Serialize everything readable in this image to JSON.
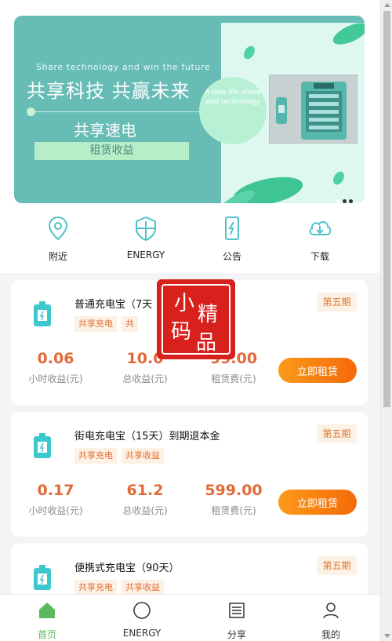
{
  "banner": {
    "en_slogan": "Share technology and win the future",
    "cn_slogan": "共享科技 共赢未来",
    "subtitle": "共享速电",
    "tag": "租赁收益",
    "bubble_text": "A new life share and technology",
    "dots": 3,
    "active_dot": 0
  },
  "quick_nav": [
    {
      "label": "附近",
      "icon": "location-pin-icon"
    },
    {
      "label": "ENERGY",
      "icon": "shield-icon"
    },
    {
      "label": "公告",
      "icon": "phone-charge-icon"
    },
    {
      "label": "下载",
      "icon": "cloud-download-icon"
    }
  ],
  "products": [
    {
      "title": "普通充电宝（7天",
      "period": "第五期",
      "tags": [
        "共享充电",
        "共"
      ],
      "hourly": "0.06",
      "hourly_label": "小时收益(元)",
      "total": "10.0",
      "total_label": "总收益(元)",
      "fee": "99.00",
      "fee_label": "租赁费(元)",
      "button": "立即租赁"
    },
    {
      "title": "街电充电宝（15天）到期退本金",
      "period": "第五期",
      "tags": [
        "共享充电",
        "共享收益"
      ],
      "hourly": "0.17",
      "hourly_label": "小时收益(元)",
      "total": "61.2",
      "total_label": "总收益(元)",
      "fee": "599.00",
      "fee_label": "租赁费(元)",
      "button": "立即租赁"
    },
    {
      "title": "便携式充电宝（90天）",
      "period": "第五期",
      "tags": [
        "共享充电",
        "共享收益"
      ]
    }
  ],
  "watermark": {
    "chars": [
      "小",
      "精",
      "码",
      "品"
    ]
  },
  "tabbar": [
    {
      "label": "首页",
      "icon": "home-icon",
      "active": true
    },
    {
      "label": "ENERGY",
      "icon": "circle-icon",
      "active": false
    },
    {
      "label": "分享",
      "icon": "list-icon",
      "active": false
    },
    {
      "label": "我的",
      "icon": "user-icon",
      "active": false
    }
  ],
  "colors": {
    "accent": "#67bcb6",
    "orange": "#f56a08",
    "green": "#5cb85c"
  }
}
